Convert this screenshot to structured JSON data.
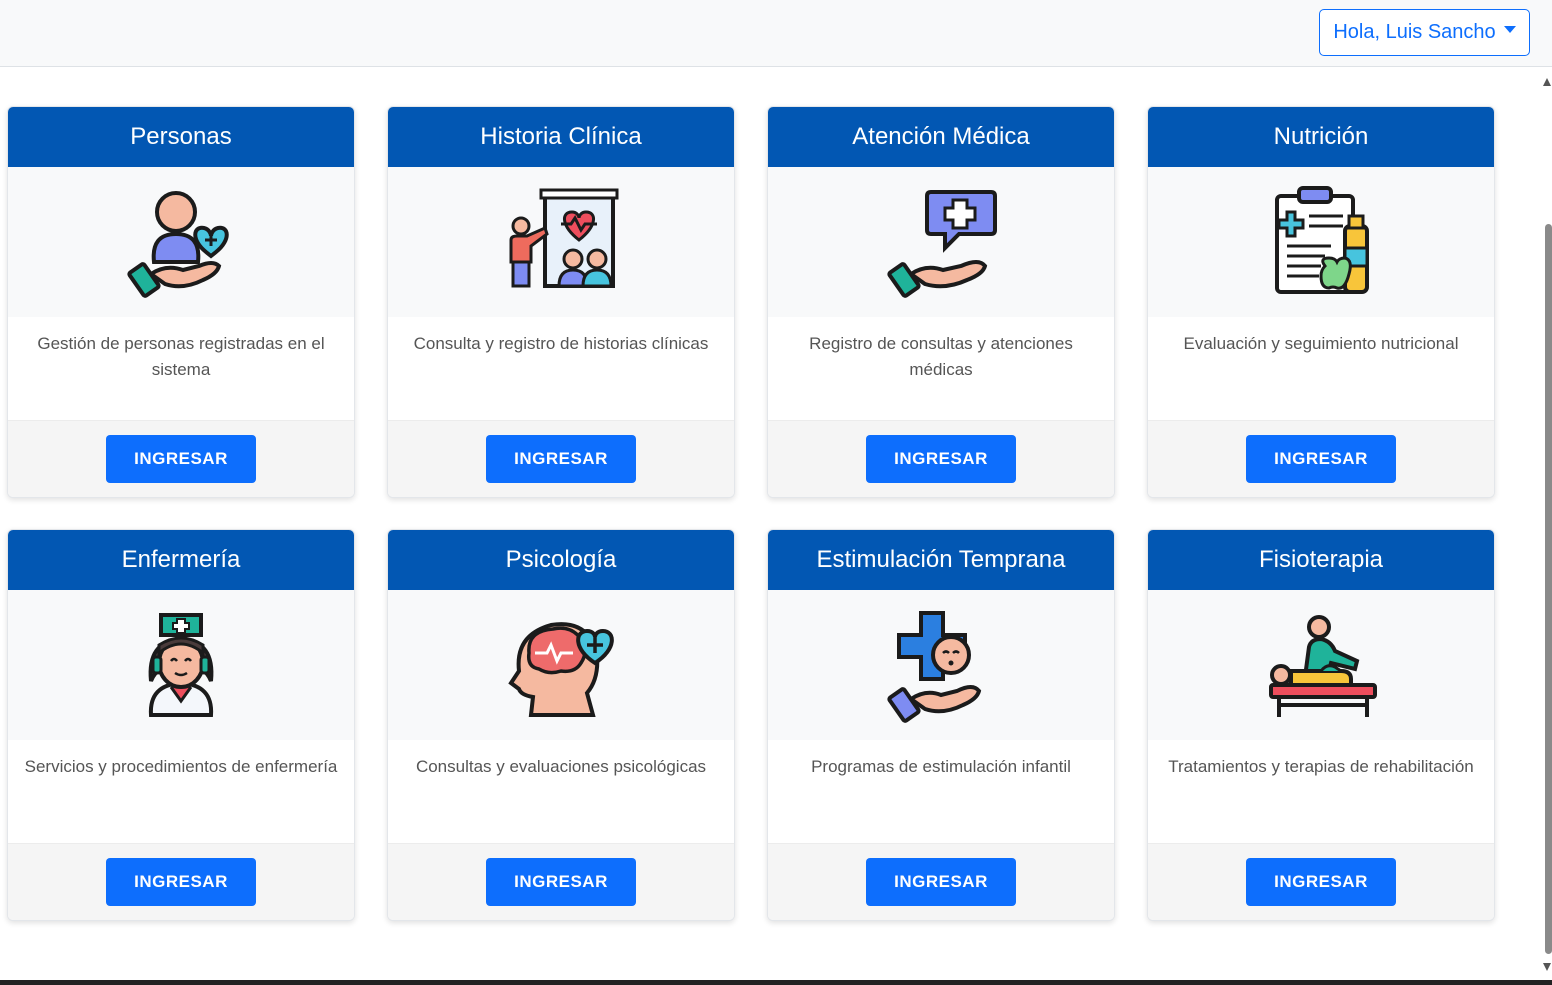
{
  "header": {
    "user_menu_label": "Hola, Luis Sancho"
  },
  "colors": {
    "card_header": "#0257b3",
    "button": "#0d6efd"
  },
  "cards": [
    {
      "title": "Personas",
      "icon": "person-care-icon",
      "description": "Gestión de personas registradas en el sistema",
      "button": "INGRESAR"
    },
    {
      "title": "Historia Clínica",
      "icon": "medical-history-icon",
      "description": "Consulta y registro de historias clínicas",
      "button": "INGRESAR"
    },
    {
      "title": "Atención Médica",
      "icon": "medical-care-icon",
      "description": "Registro de consultas y atenciones médicas",
      "button": "INGRESAR"
    },
    {
      "title": "Nutrición",
      "icon": "nutrition-clipboard-icon",
      "description": "Evaluación y seguimiento nutricional",
      "button": "INGRESAR"
    },
    {
      "title": "Enfermería",
      "icon": "nurse-icon",
      "description": "Servicios y procedimientos de enfermería",
      "button": "INGRESAR"
    },
    {
      "title": "Psicología",
      "icon": "brain-heart-icon",
      "description": "Consultas y evaluaciones psicológicas",
      "button": "INGRESAR"
    },
    {
      "title": "Estimulación Temprana",
      "icon": "baby-care-icon",
      "description": "Programas de estimulación infantil",
      "button": "INGRESAR"
    },
    {
      "title": "Fisioterapia",
      "icon": "physiotherapy-icon",
      "description": "Tratamientos y terapias de rehabilitación",
      "button": "INGRESAR"
    }
  ]
}
